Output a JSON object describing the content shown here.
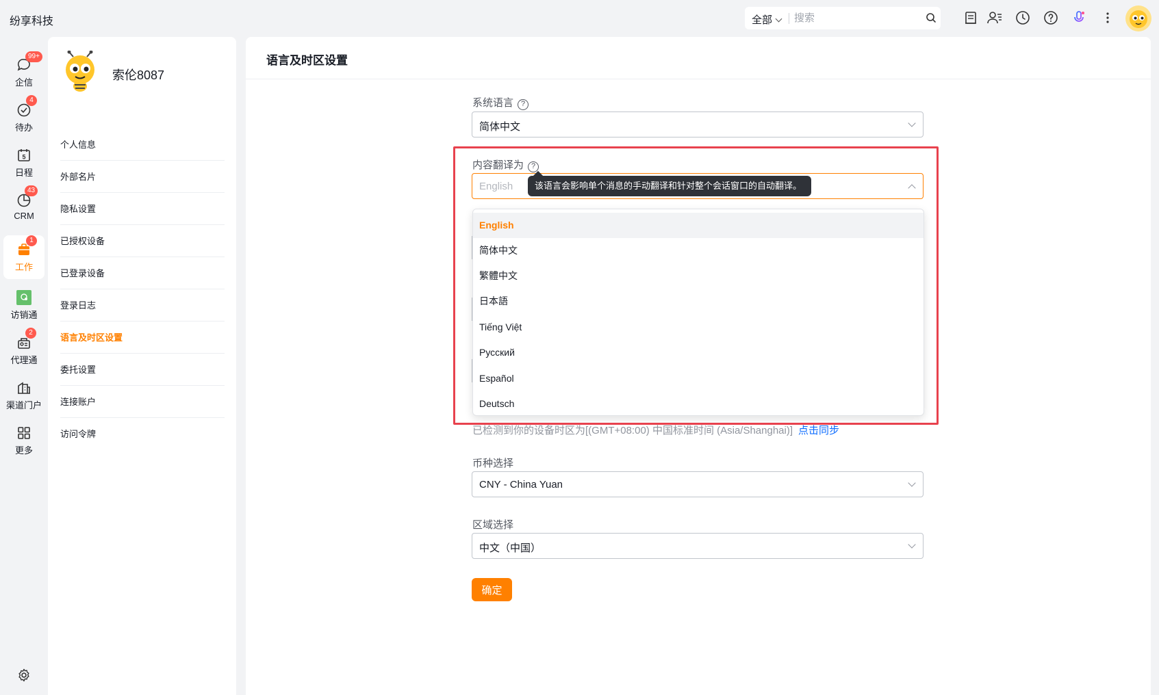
{
  "app": {
    "brand": "纷享科技"
  },
  "topbar": {
    "search_scope": "全部",
    "search_placeholder": "搜索",
    "icons": [
      "document-icon",
      "contacts-icon",
      "clock-icon",
      "help-icon",
      "voice-assistant-icon",
      "more-icon"
    ]
  },
  "nav": {
    "items": [
      {
        "label": "企信",
        "badge": "99+",
        "icon": "chat-icon"
      },
      {
        "label": "待办",
        "badge": "4",
        "icon": "check-circle-icon"
      },
      {
        "label": "日程",
        "badge": "",
        "icon": "calendar-icon",
        "day": "5"
      },
      {
        "label": "CRM",
        "badge": "43",
        "icon": "pie-chart-icon"
      },
      {
        "label": "工作",
        "badge": "1",
        "icon": "briefcase-icon",
        "active": true
      },
      {
        "label": "访销通",
        "badge": "",
        "icon": "app-icon"
      },
      {
        "label": "代理通",
        "badge": "2",
        "icon": "agent-icon"
      },
      {
        "label": "渠道门户",
        "badge": "",
        "icon": "building-icon"
      },
      {
        "label": "更多",
        "badge": "",
        "icon": "grid-icon"
      }
    ],
    "accent": "#ff8000"
  },
  "profile": {
    "username": "索伦8087",
    "menu": [
      {
        "label": "个人信息"
      },
      {
        "label": "外部名片"
      },
      {
        "label": "隐私设置"
      },
      {
        "label": "已授权设备"
      },
      {
        "label": "已登录设备"
      },
      {
        "label": "登录日志"
      },
      {
        "label": "语言及时区设置",
        "active": true
      },
      {
        "label": "委托设置"
      },
      {
        "label": "连接账户"
      },
      {
        "label": "访问令牌"
      }
    ]
  },
  "main": {
    "title": "语言及时区设置",
    "system_language": {
      "label": "系统语言",
      "value": "简体中文"
    },
    "translate": {
      "label": "内容翻译为",
      "placeholder": "English",
      "tooltip": "该语言会影响单个消息的手动翻译和针对整个会话窗口的自动翻译。",
      "options": [
        "English",
        "简体中文",
        "繁體中文",
        "日本語",
        "Tiếng Việt",
        "Русский",
        "Español",
        "Deutsch"
      ],
      "selected": "English"
    },
    "timezone_notice": "已检测到你的设备时区为[(GMT+08:00) 中国标准时间 (Asia/Shanghai)]",
    "timezone_sync": "点击同步",
    "currency": {
      "label": "币种选择",
      "value": "CNY - China Yuan"
    },
    "region": {
      "label": "区域选择",
      "value": "中文（中国）"
    },
    "confirm_label": "确定"
  },
  "colors": {
    "accent": "#ff8000",
    "highlight_box": "#e8424e",
    "link": "#0c6cff"
  }
}
